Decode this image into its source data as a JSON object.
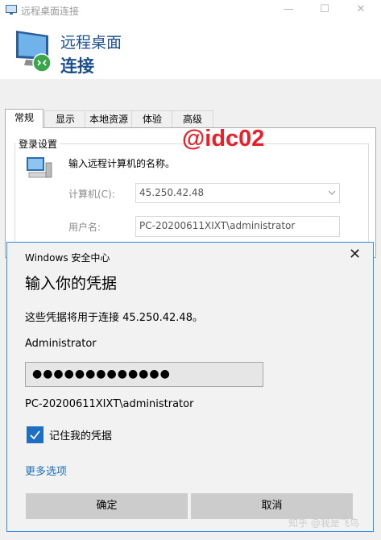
{
  "window": {
    "title": "远程桌面连接",
    "minimize_glyph": "—",
    "maximize_glyph": "☐",
    "close_glyph": "✕"
  },
  "header": {
    "line1": "远程桌面",
    "line2": "连接"
  },
  "tabs": [
    {
      "label": "常规",
      "active": true
    },
    {
      "label": "显示"
    },
    {
      "label": "本地资源"
    },
    {
      "label": "体验"
    },
    {
      "label": "高级"
    }
  ],
  "login_settings": {
    "group_label": "登录设置",
    "instruction": "输入远程计算机的名称。",
    "computer_label": "计算机(C):",
    "computer_value": "45.250.42.48",
    "user_label": "用户名:",
    "user_value": "PC-20200611XIXT\\administrator"
  },
  "watermark": "@idc02",
  "dialog": {
    "title": "Windows 安全中心",
    "close_glyph": "✕",
    "heading": "输入你的凭据",
    "description": "这些凭据将用于连接 45.250.42.48。",
    "username": "Administrator",
    "password_mask": "●●●●●●●●●●●●●",
    "domain_user": "PC-20200611XIXT\\administrator",
    "remember_label": "记住我的凭据",
    "remember_checked": true,
    "more_options": "更多选项",
    "ok_label": "确定",
    "cancel_label": "取消",
    "accent_color": "#1e6fc4"
  },
  "footer_watermark": "知乎 @我是飞鸟",
  "icons": [
    "remote-desktop-icon",
    "monitor-icon",
    "computer-icon",
    "chevron-down-icon",
    "close-icon",
    "checkmark-icon"
  ]
}
